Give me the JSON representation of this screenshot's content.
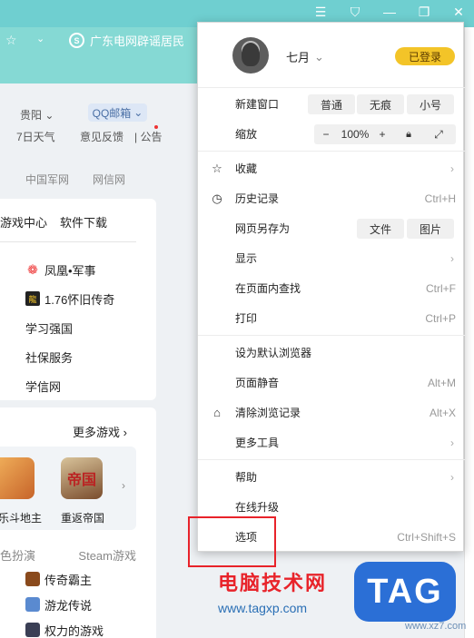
{
  "window": {
    "controls": [
      "menu",
      "skin",
      "minimize",
      "restore",
      "close"
    ]
  },
  "tab": {
    "site_logo": "S",
    "site_title": "广东电网辟谣居民"
  },
  "page": {
    "city": "贵阳",
    "weather": "7日天气",
    "mail_label": "QQ邮箱",
    "feedback": "意见反馈",
    "notice": "公告",
    "links": [
      "中国军网",
      "网信网"
    ],
    "card1_tabs": [
      "游戏中心",
      "软件下载"
    ],
    "card1_items": [
      {
        "icon": "fenghuang-icon",
        "label": "凤凰•军事"
      },
      {
        "icon": "game-icon",
        "label": "1.76怀旧传奇"
      },
      {
        "icon": "",
        "label": "学习强国"
      },
      {
        "icon": "",
        "label": "社保服务"
      },
      {
        "icon": "",
        "label": "学信网"
      }
    ],
    "more_games": "更多游戏",
    "games": [
      {
        "name": "乐斗地主",
        "color": "#d98a3c"
      },
      {
        "name": "重返帝国",
        "color": "#8c5a3a"
      }
    ],
    "card2_tabs": [
      "色扮演",
      "Steam游戏"
    ],
    "card2_items": [
      "传奇霸主",
      "游龙传说",
      "权力的游戏"
    ]
  },
  "menu": {
    "user": {
      "name": "七月",
      "login_label": "已登录"
    },
    "new_window": {
      "label": "新建窗口",
      "options": [
        "普通",
        "无痕",
        "小号"
      ]
    },
    "zoom": {
      "label": "缩放",
      "minus": "−",
      "value": "100%",
      "plus": "+"
    },
    "favorites": "收藏",
    "history": {
      "label": "历史记录",
      "shortcut": "Ctrl+H"
    },
    "save_as": {
      "label": "网页另存为",
      "options": [
        "文件",
        "图片"
      ]
    },
    "display": "显示",
    "find": {
      "label": "在页面内查找",
      "shortcut": "Ctrl+F"
    },
    "print": {
      "label": "打印",
      "shortcut": "Ctrl+P"
    },
    "set_default": "设为默认浏览器",
    "mute": {
      "label": "页面静音",
      "shortcut": "Alt+M"
    },
    "clear": {
      "label": "清除浏览记录",
      "shortcut": "Alt+X"
    },
    "more_tools": "更多工具",
    "help": "帮助",
    "upgrade": "在线升级",
    "options": {
      "label": "选项",
      "shortcut": "Ctrl+Shift+S"
    }
  },
  "watermark": {
    "title": "电脑技术网",
    "url": "www.tagxp.com",
    "badge": "TAG",
    "badge_sub": "www.xz7.com"
  },
  "colors": {
    "topbar": "#6fcfd0",
    "login_button": "#f3c428",
    "highlight_border": "#e8232a",
    "badge": "#2b6fd6"
  }
}
